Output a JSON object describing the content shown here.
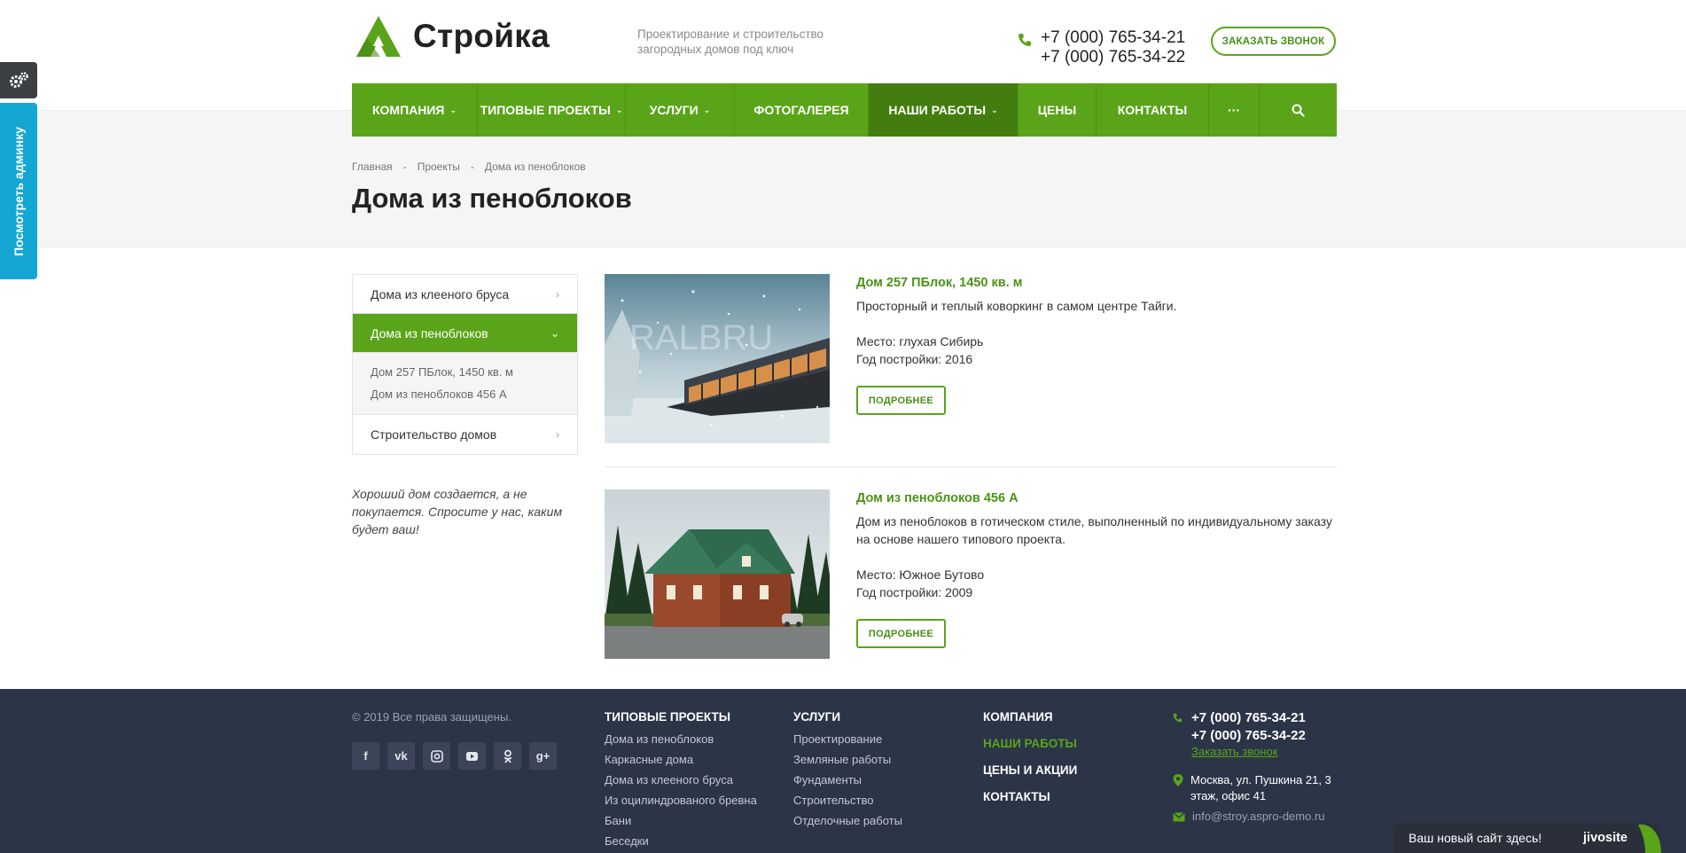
{
  "brand": {
    "name": "Стройка",
    "tagline": "Проектирование и строительство загородных домов под ключ",
    "accent_color": "#5aa419"
  },
  "header": {
    "phones": [
      "+7 (000) 765-34-21",
      "+7 (000) 765-34-22"
    ],
    "callback_label": "ЗАКАЗАТЬ ЗВОНОК"
  },
  "nav": {
    "items": [
      {
        "label": "КОМПАНИЯ"
      },
      {
        "label": "ТИПОВЫЕ ПРОЕКТЫ"
      },
      {
        "label": "УСЛУГИ"
      },
      {
        "label": "ФОТОГАЛЕРЕЯ"
      },
      {
        "label": "НАШИ РАБОТЫ"
      },
      {
        "label": "ЦЕНЫ"
      },
      {
        "label": "КОНТАКТЫ"
      },
      {
        "label": "···"
      }
    ],
    "active_index": 4,
    "search_icon": "search-icon"
  },
  "breadcrumb": {
    "items": [
      "Главная",
      "Проекты",
      "Дома из пеноблоков"
    ],
    "separator": "-"
  },
  "page_title": "Дома из пеноблоков",
  "side_tools": {
    "admin_label": "Посмотреть админку",
    "settings_icon": "gears-icon"
  },
  "side_menu": {
    "items": [
      {
        "label": "Дома из клееного бруса"
      },
      {
        "label": "Дома из пеноблоков"
      },
      {
        "label": "Строительство домов"
      }
    ],
    "sub_items": [
      "Дом 257 ПБлок, 1450 кв. м",
      "Дом из пеноблоков 456 А"
    ]
  },
  "quote": "Хороший дом создается, а не покупается. Спросите у нас, каким будет ваш!",
  "items": [
    {
      "title": "Дом 257 ПБлок, 1450 кв. м",
      "description": "Просторный и теплый коворкинг в самом центре Тайги.",
      "place": "Место: глухая Сибирь",
      "year": "Год постройки: 2016",
      "button": "ПОДРОБНЕЕ",
      "watermark": "RALBRU"
    },
    {
      "title": "Дом из пеноблоков 456 А",
      "description": "Дом из пеноблоков в готическом стиле, выполненный по индивидуальному заказу на основе нашего типового проекта.",
      "place": "Место: Южное Бутово",
      "year": "Год постройки: 2009",
      "button": "ПОДРОБНЕЕ"
    }
  ],
  "footer": {
    "copyright": "© 2019 Все права защищены.",
    "socials": [
      "f",
      "vk",
      "ig",
      "yt",
      "ok",
      "g+"
    ],
    "columns": [
      {
        "title": "ТИПОВЫЕ ПРОЕКТЫ",
        "links": [
          "Дома из пеноблоков",
          "Каркасные дома",
          "Дома из клееного бруса",
          "Из оцилиндрованого бревна",
          "Бани",
          "Беседки"
        ]
      },
      {
        "title": "УСЛУГИ",
        "links": [
          "Проектирование",
          "Земляные работы",
          "Фундаменты",
          "Строительство",
          "Отделочные работы"
        ]
      }
    ],
    "menu": [
      {
        "label": "КОМПАНИЯ"
      },
      {
        "label": "НАШИ РАБОТЫ"
      },
      {
        "label": "ЦЕНЫ И АКЦИИ"
      },
      {
        "label": "КОНТАКТЫ"
      }
    ],
    "menu_active_index": 1,
    "phones": [
      "+7 (000) 765-34-21",
      "+7 (000) 765-34-22"
    ],
    "callback_link": "Заказать звонок",
    "address": "Москва, ул. Пушкина 21, 3 этаж, офис 41",
    "email": "info@stroy.aspro-demo.ru"
  },
  "jivo": {
    "text": "Ваш новый сайт здесь!",
    "logo": "jivosite"
  }
}
